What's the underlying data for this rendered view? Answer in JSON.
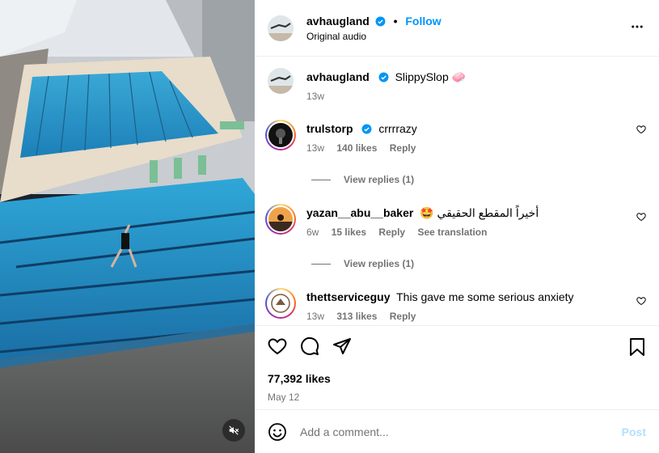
{
  "post": {
    "author": "avhaugland",
    "follow_label": "Follow",
    "dot": "•",
    "audio": "Original audio",
    "caption": {
      "username": "avhaugland",
      "text": "SlippySlop 🧼",
      "time": "13w"
    },
    "likes": "77,392 likes",
    "date": "May 12"
  },
  "comments": [
    {
      "username": "trulstorp",
      "verified": true,
      "text": "crrrrazy",
      "time": "13w",
      "likes": "140 likes",
      "reply": "Reply",
      "view_replies": "View replies (1)"
    },
    {
      "username": "yazan__abu__baker",
      "verified": false,
      "text": "🤩 أخيراً المقطع الحقيقي",
      "time": "6w",
      "likes": "15 likes",
      "reply": "Reply",
      "translation": "See translation",
      "view_replies": "View replies (1)"
    },
    {
      "username": "thettserviceguy",
      "verified": false,
      "text": "This gave me some serious anxiety",
      "time": "13w",
      "likes": "313 likes",
      "reply": "Reply"
    }
  ],
  "add_comment": {
    "placeholder": "Add a comment...",
    "post_label": "Post"
  },
  "icons": {
    "verified": "verified-badge-icon",
    "more": "more-options-icon",
    "like": "heart-icon",
    "comment": "comment-icon",
    "share": "share-icon",
    "save": "bookmark-icon",
    "emoji": "emoji-icon",
    "mute": "muted-speaker-icon"
  },
  "colors": {
    "link": "#0095f6",
    "verified": "#0095f6",
    "secondary_text": "#737373",
    "post_disabled": "#b2dffc"
  }
}
